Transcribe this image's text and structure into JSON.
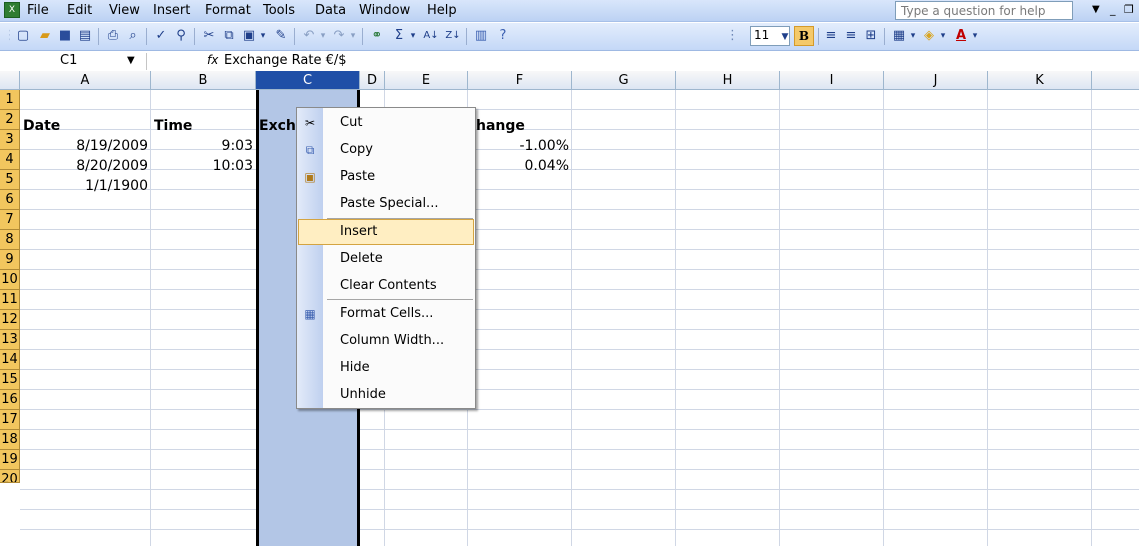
{
  "menubar": {
    "items": [
      "File",
      "Edit",
      "View",
      "Insert",
      "Format",
      "Tools",
      "Data",
      "Window",
      "Help"
    ],
    "help_placeholder": "Type a question for help"
  },
  "toolbar": {
    "font_size": "11",
    "bold": "B"
  },
  "formula_bar": {
    "name_box": "C1",
    "fx": "fx",
    "content": "Exchange Rate €/$"
  },
  "columns": [
    "A",
    "B",
    "C",
    "D",
    "E",
    "F",
    "G",
    "H",
    "I",
    "J",
    "K"
  ],
  "rows": [
    "1",
    "2",
    "3",
    "4",
    "5",
    "6",
    "7",
    "8",
    "9",
    "10",
    "11",
    "12",
    "13",
    "14",
    "15",
    "16",
    "17",
    "18",
    "19",
    "20"
  ],
  "cells": {
    "A1": "Date",
    "B1": "Time",
    "C1": "Exch",
    "F1": "hange",
    "A2": "8/19/2009",
    "B2": "9:03",
    "F2": "-1.00%",
    "A3": "8/20/2009",
    "B3": "10:03",
    "F3": "0.04%",
    "A4": "1/1/1900"
  },
  "context_menu": {
    "cut": "Cut",
    "copy": "Copy",
    "paste": "Paste",
    "paste_special": "Paste Special...",
    "insert": "Insert",
    "delete": "Delete",
    "clear_contents": "Clear Contents",
    "format_cells": "Format Cells...",
    "column_width": "Column Width...",
    "hide": "Hide",
    "unhide": "Unhide"
  }
}
